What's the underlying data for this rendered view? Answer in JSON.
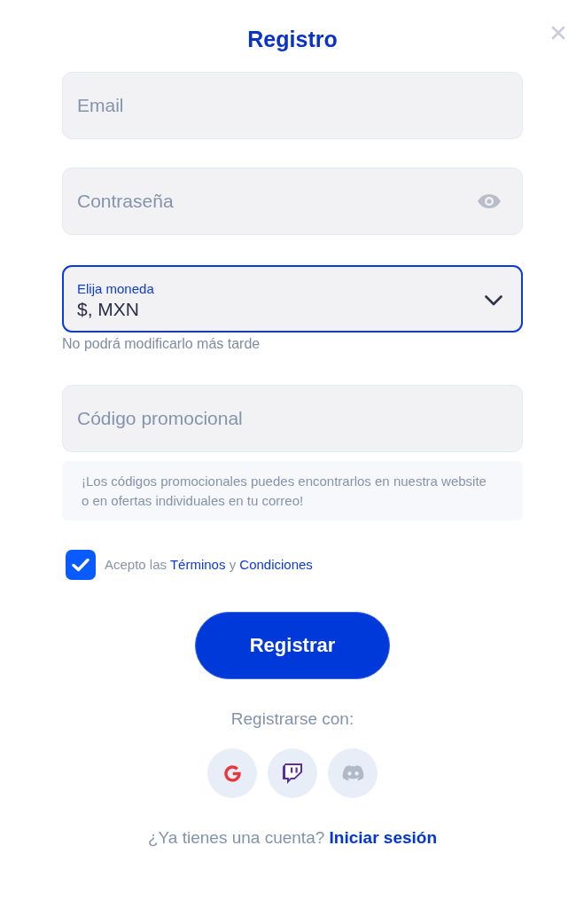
{
  "title": "Registro",
  "fields": [
    {
      "kind": "text",
      "placeholder": "Email",
      "focused": false
    },
    {
      "kind": "password",
      "placeholder": "Contraseña",
      "focused": false
    },
    {
      "kind": "select",
      "label": "Elija moneda",
      "value": "$, MXN",
      "focused": true,
      "hint": "No podrá modificarlo más tarde"
    },
    {
      "kind": "text",
      "placeholder": "Código promocional",
      "focused": false,
      "note": "¡Los códigos promocionales puedes encontrarlos en nuestra website o en ofertas individuales en tu correo!"
    }
  ],
  "terms": {
    "checked": true,
    "parts": [
      {
        "kind": "text",
        "text": "Acepto las"
      },
      {
        "kind": "link",
        "text": "Términos"
      },
      {
        "kind": "text",
        "text": "y"
      },
      {
        "kind": "link",
        "text": "Condiciones"
      }
    ]
  },
  "submit": {
    "label": "Registrar"
  },
  "social": {
    "heading": "Registrarse con:",
    "buttons": [
      {
        "kind": "google"
      },
      {
        "kind": "twitch"
      },
      {
        "kind": "discord"
      }
    ]
  },
  "footer": {
    "text": "¿Ya tienes una cuenta?",
    "link": "Iniciar sesión"
  }
}
